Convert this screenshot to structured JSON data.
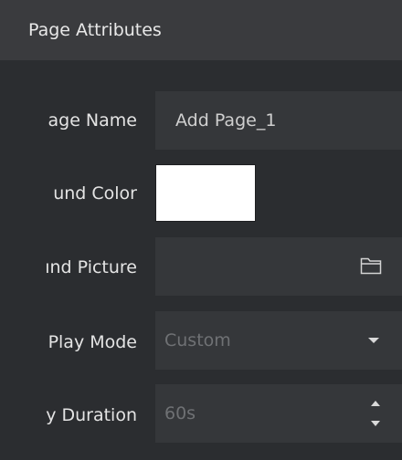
{
  "header": {
    "title": "Page Attributes"
  },
  "rows": {
    "page_name": {
      "label": "age Name",
      "value": "Add Page_1"
    },
    "background_color": {
      "label": "und Color",
      "color": "#ffffff"
    },
    "background_picture": {
      "label": "ınd Picture",
      "icon": "folder-icon"
    },
    "play_mode": {
      "label": "Play Mode",
      "value": "Custom",
      "icon": "chevron-down-icon"
    },
    "play_duration": {
      "label": "y Duration",
      "value": "60s",
      "icon": "stepper-icon"
    }
  },
  "colors": {
    "panel_bg": "#2b2d30",
    "header_bg": "#3a3b3e",
    "field_bg": "#35373a",
    "text": "#e4e4e4",
    "disabled_text": "#6f7174"
  }
}
